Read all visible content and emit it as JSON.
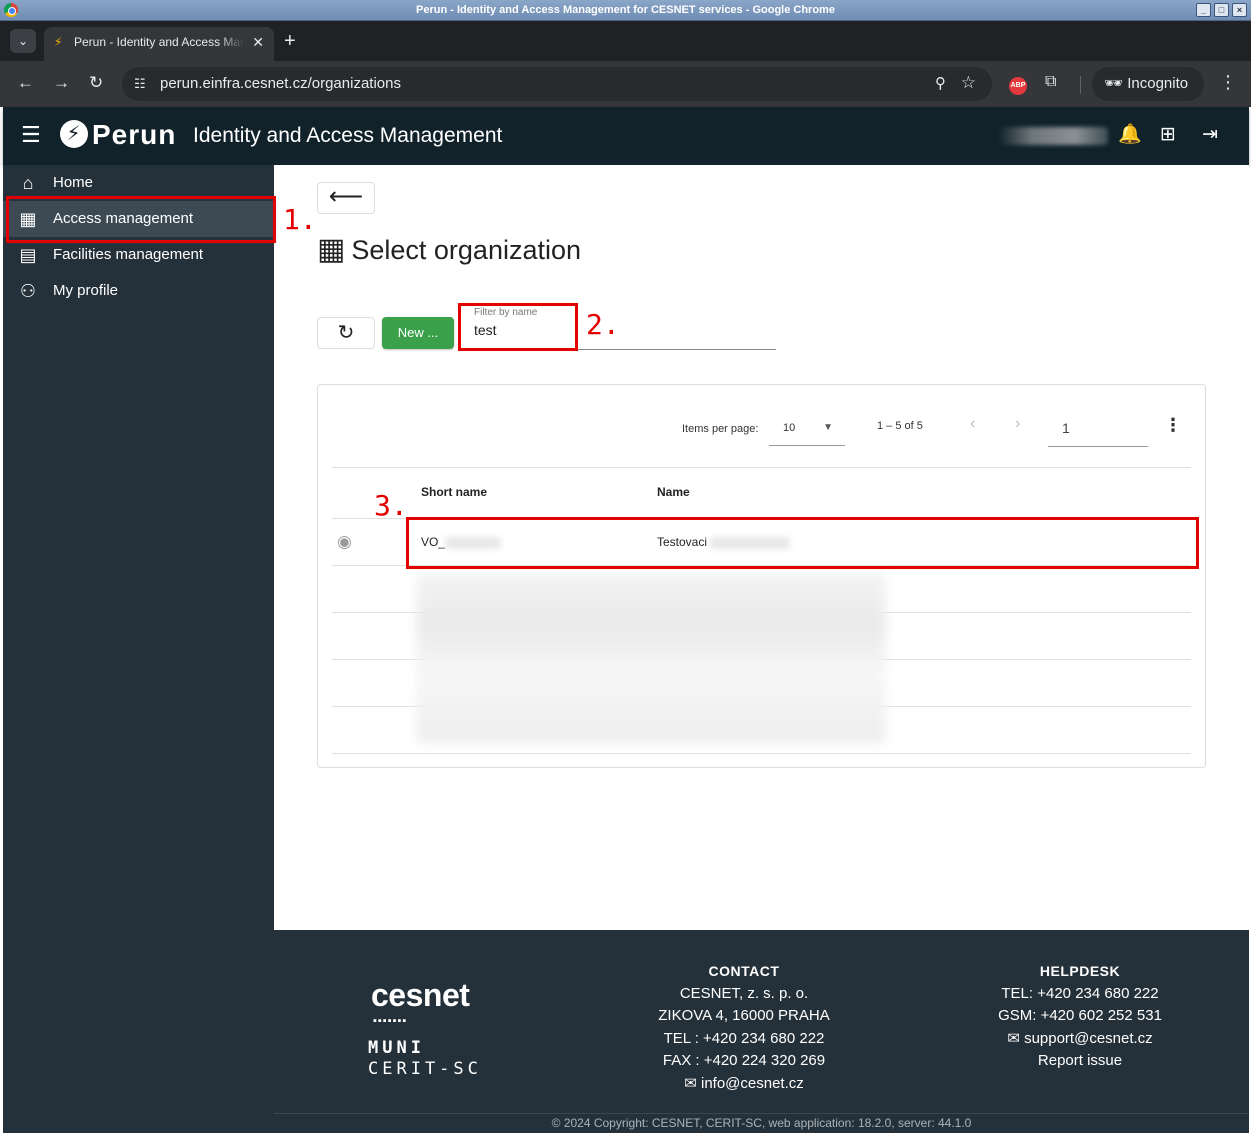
{
  "window": {
    "title": "Perun - Identity and Access Management for CESNET services - Google Chrome",
    "buttons": [
      "_",
      "□",
      "×"
    ]
  },
  "browser": {
    "tab_title": "Perun - Identity and Access Management for CESNET services",
    "new_tab_label": "+",
    "url": "perun.einfra.cesnet.cz/organizations",
    "incognito_label": "Incognito",
    "abp_label": "ABP"
  },
  "header": {
    "logo_text": "Perun",
    "title": "Identity and Access Management"
  },
  "sidebar": {
    "items": [
      {
        "label": "Home",
        "icon": "home-icon",
        "active": false
      },
      {
        "label": "Access management",
        "icon": "building-icon",
        "active": true
      },
      {
        "label": "Facilities management",
        "icon": "facility-icon",
        "active": false
      },
      {
        "label": "My profile",
        "icon": "person-icon",
        "active": false
      }
    ]
  },
  "annotations": {
    "step1": "1.",
    "step2": "2.",
    "step3": "3."
  },
  "main": {
    "page_title": "Select organization",
    "new_button_label": "New ...",
    "filter": {
      "label": "Filter by name",
      "value": "test"
    },
    "paginator": {
      "items_per_page_label": "Items per page:",
      "items_per_page_value": "10",
      "range_label": "1 – 5 of 5",
      "page_value": "1"
    },
    "table": {
      "columns": [
        "Short name",
        "Name"
      ],
      "rows": [
        {
          "short_name": "VO_",
          "name": "Testovaci"
        }
      ]
    }
  },
  "footer": {
    "logo_cesnet": "cesnet",
    "logo_muni": "MUNI",
    "logo_cerit": "CERIT-SC",
    "contact": {
      "heading": "CONTACT",
      "lines": [
        "CESNET, z. s. p. o.",
        "ZIKOVA 4, 16000 PRAHA",
        "TEL : +420 234 680 222",
        "FAX : +420 224 320 269"
      ],
      "email": "info@cesnet.cz"
    },
    "helpdesk": {
      "heading": "HELPDESK",
      "tel": "TEL: +420 234 680 222",
      "gsm": "GSM: +420 602 252 531",
      "email": "support@cesnet.cz",
      "report": "Report issue"
    },
    "copyright": "© 2024 Copyright: CESNET, CERIT-SC, web application: 18.2.0, server: 44.1.0"
  },
  "colors": {
    "header_bg": "#11222a",
    "sidebar_bg": "#25313a",
    "new_button": "#3aa14a",
    "annotation_red": "#e50000"
  }
}
